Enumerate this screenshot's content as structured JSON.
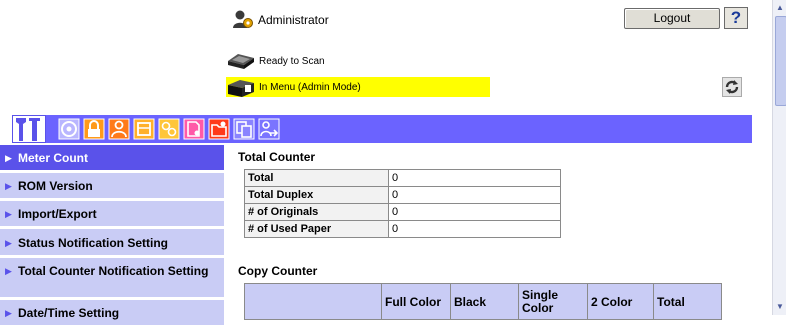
{
  "header": {
    "user_label": "Administrator",
    "logout_label": "Logout",
    "help_label": "?",
    "status_lines": [
      "Ready to Scan",
      "In Menu (Admin Mode)"
    ],
    "status_highlight_color": "#ffff00",
    "icons": [
      "admin-user-icon",
      "scanner-icon",
      "refresh-icon"
    ]
  },
  "tabs": [
    {
      "name": "maintenance-tab",
      "icon": "wrench-screwdriver-icon",
      "selected": true
    },
    {
      "name": "system-settings-tab",
      "icon": "disc-settings-icon"
    },
    {
      "name": "security-tab",
      "icon": "padlock-icon"
    },
    {
      "name": "user-auth-tab",
      "icon": "user-icon"
    },
    {
      "name": "address-book-tab",
      "icon": "box-icon"
    },
    {
      "name": "network-tab",
      "icon": "gears-icon"
    },
    {
      "name": "print-settings-tab",
      "icon": "document-settings-icon"
    },
    {
      "name": "store-address-tab",
      "icon": "folder-gear-icon"
    },
    {
      "name": "box-tab",
      "icon": "copy-document-icon"
    },
    {
      "name": "logout-tab",
      "icon": "person-arrow-icon"
    }
  ],
  "tab_bar_color": "#6b63ff",
  "sidebar": {
    "items": [
      {
        "label": "Meter Count",
        "selected": true
      },
      {
        "label": "ROM Version"
      },
      {
        "label": "Import/Export"
      },
      {
        "label": "Status Notification Setting"
      },
      {
        "label": "Total Counter Notification Setting"
      },
      {
        "label": "Date/Time Setting"
      }
    ],
    "selected_color": "#5a52ea",
    "item_color": "#c9ccf5"
  },
  "total_counter": {
    "title": "Total Counter",
    "rows": [
      {
        "label": "Total",
        "value": "0"
      },
      {
        "label": "Total Duplex",
        "value": "0"
      },
      {
        "label": "# of Originals",
        "value": "0"
      },
      {
        "label": "# of Used Paper",
        "value": "0"
      }
    ]
  },
  "copy_counter": {
    "title": "Copy Counter",
    "columns": [
      "",
      "Full Color",
      "Black",
      "Single Color",
      "2 Color",
      "Total"
    ]
  }
}
